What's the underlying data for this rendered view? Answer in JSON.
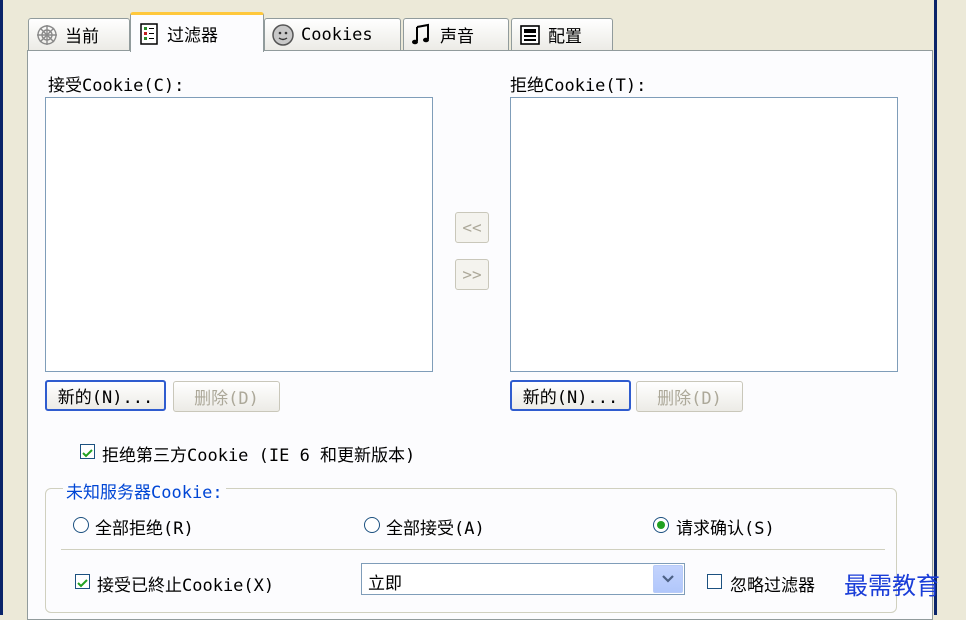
{
  "tabs": [
    {
      "label": "当前",
      "icon": "web-icon"
    },
    {
      "label": "过滤器",
      "icon": "filter-list-icon",
      "active": true
    },
    {
      "label": "Cookies",
      "icon": "cookie-face-icon"
    },
    {
      "label": "声音",
      "icon": "music-note-icon"
    },
    {
      "label": "配置",
      "icon": "config-icon"
    }
  ],
  "accept": {
    "label": "接受Cookie(C):",
    "new_button": "新的(N)...",
    "delete_button": "删除(D)"
  },
  "reject": {
    "label": "拒绝Cookie(T):",
    "new_button": "新的(N)...",
    "delete_button": "删除(D)"
  },
  "move": {
    "left": "<<",
    "right": ">>"
  },
  "third_party": {
    "label": "拒绝第三方Cookie (IE 6 和更新版本)",
    "checked": true
  },
  "unknown_server": {
    "title": "未知服务器Cookie:",
    "options": [
      "全部拒绝(R)",
      "全部接受(A)",
      "请求确认(S)"
    ],
    "selected": 2
  },
  "expired": {
    "label": "接受已終止Cookie(X)",
    "checked": true,
    "select_value": "立即",
    "ignore_label": "忽略过滤器",
    "ignore_checked": false
  },
  "watermark": "最需教育",
  "colors": {
    "frame": "#0A246A",
    "panel": "#FCFCFE",
    "tab_active_top": "#FFC83C",
    "group_title": "#0046D5",
    "radio_dot": "#21A121"
  }
}
